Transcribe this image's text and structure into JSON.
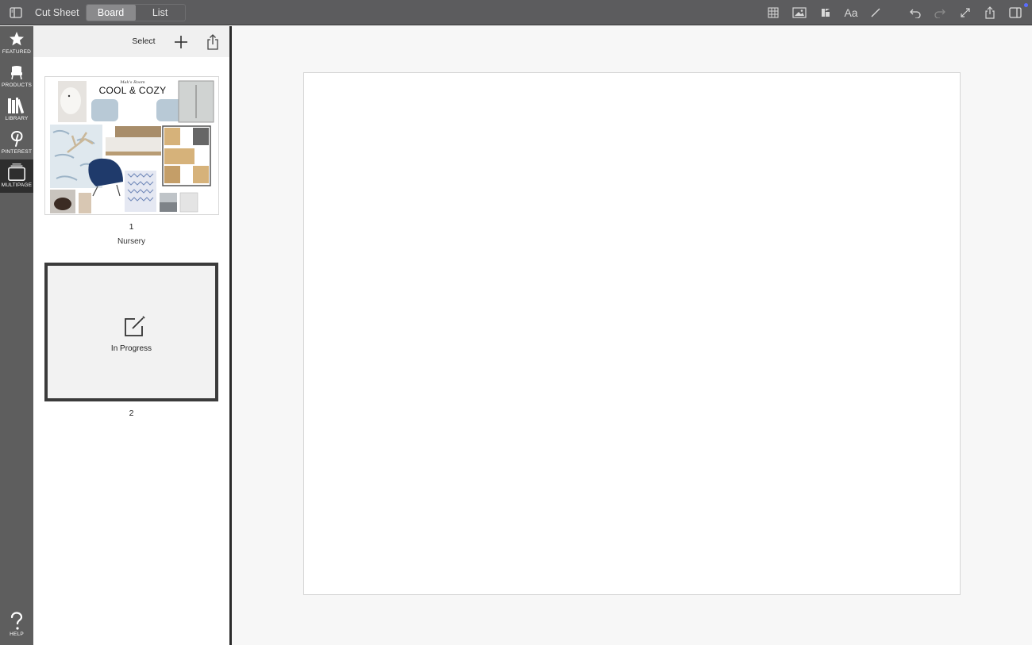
{
  "topbar": {
    "sidebar_toggle_icon": "sidebar-left-icon",
    "title": "Cut Sheet",
    "tabs": [
      {
        "label": "Board",
        "active": true
      },
      {
        "label": "List",
        "active": false
      }
    ],
    "tools": [
      "grid-icon",
      "image-icon",
      "shapes-icon",
      "text-icon",
      "line-icon",
      "undo-icon",
      "redo-icon",
      "expand-icon",
      "share-icon",
      "sidebar-right-icon"
    ],
    "text_tool_label": "Aa",
    "notification_color": "#5a6cff"
  },
  "rail": {
    "items": [
      {
        "label": "FEATURED",
        "icon": "star-icon"
      },
      {
        "label": "PRODUCTS",
        "icon": "chair-icon"
      },
      {
        "label": "LIBRARY",
        "icon": "books-icon"
      },
      {
        "label": "PINTEREST",
        "icon": "pinterest-icon"
      },
      {
        "label": "MULTIPAGE",
        "icon": "pages-icon",
        "active": true
      },
      {
        "label": "HELP",
        "icon": "question-icon"
      }
    ]
  },
  "panel": {
    "select_label": "Select",
    "pages": [
      {
        "number": "1",
        "name": "Nursery",
        "thumbnail": {
          "subtitle": "Mak's Room",
          "title": "COOL & COZY"
        }
      },
      {
        "number": "2",
        "status": "In Progress",
        "selected": true
      }
    ]
  },
  "colors": {
    "topbar": "#5c5c5e",
    "rail": "#5e5e5e",
    "rail_active": "#2e2e2e",
    "canvas_bg": "#f7f7f7"
  }
}
